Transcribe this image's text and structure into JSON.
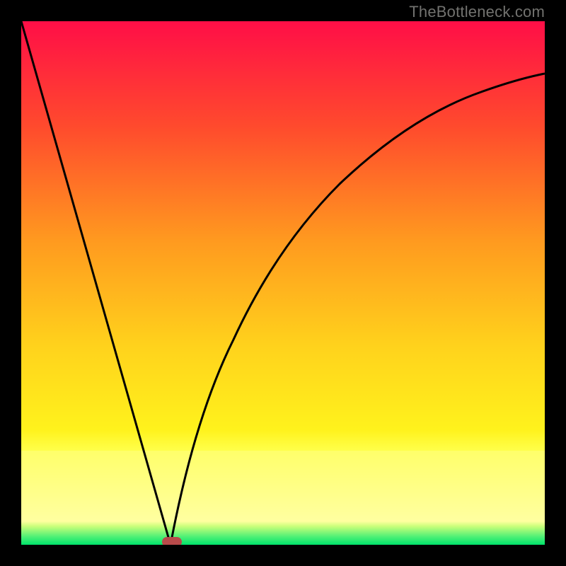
{
  "watermark": "TheBottleneck.com",
  "colors": {
    "frame": "#000000",
    "curve": "#000000",
    "marker": "#b84a4a",
    "gradient_top": "#ff0e47",
    "gradient_mid_upper": "#ff8a1f",
    "gradient_mid": "#ffd21c",
    "gradient_mid_lower": "#fff21c",
    "gradient_low_band": "#ffff6a",
    "gradient_bottom": "#00e36b"
  },
  "chart_data": {
    "type": "line",
    "title": "",
    "xlabel": "",
    "ylabel": "",
    "xlim": [
      0,
      100
    ],
    "ylim": [
      0,
      100
    ],
    "legend": false,
    "grid": false,
    "series": [
      {
        "name": "left-branch",
        "x": [
          0,
          5,
          10,
          15,
          20,
          25,
          27,
          28.5
        ],
        "values": [
          100,
          82,
          65,
          47,
          30,
          12,
          5,
          0
        ]
      },
      {
        "name": "right-branch",
        "x": [
          28.5,
          30,
          33,
          37,
          42,
          48,
          55,
          63,
          72,
          82,
          92,
          100
        ],
        "values": [
          0,
          6,
          17,
          30,
          43,
          54,
          63,
          71,
          78,
          83,
          87,
          90
        ]
      }
    ],
    "marker": {
      "name": "minimum-point",
      "x": 28.5,
      "y": 0,
      "shape": "rounded-rect"
    },
    "background_bands_y_pct_from_top": [
      {
        "color": "gradient",
        "from": 0,
        "to": 78
      },
      {
        "color": "#fff21c",
        "from": 78,
        "to": 82
      },
      {
        "color": "#ffff6a",
        "from": 82,
        "to": 96
      },
      {
        "color": "gradient-green",
        "from": 96,
        "to": 100
      }
    ]
  }
}
